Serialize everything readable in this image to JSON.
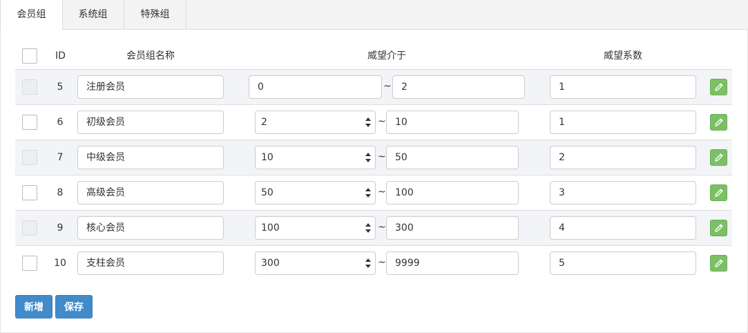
{
  "tabs": [
    {
      "label": "会员组",
      "active": true
    },
    {
      "label": "系统组",
      "active": false
    },
    {
      "label": "特殊组",
      "active": false
    }
  ],
  "table": {
    "headers": {
      "id": "ID",
      "name": "会员组名称",
      "range": "威望介于",
      "coef": "威望系数"
    },
    "separator": "~",
    "rows": [
      {
        "id": "5",
        "name": "注册会员",
        "min": "0",
        "max": "2",
        "coef": "1",
        "min_is_select": false
      },
      {
        "id": "6",
        "name": "初级会员",
        "min": "2",
        "max": "10",
        "coef": "1",
        "min_is_select": true
      },
      {
        "id": "7",
        "name": "中级会员",
        "min": "10",
        "max": "50",
        "coef": "2",
        "min_is_select": true
      },
      {
        "id": "8",
        "name": "高级会员",
        "min": "50",
        "max": "100",
        "coef": "3",
        "min_is_select": true
      },
      {
        "id": "9",
        "name": "核心会员",
        "min": "100",
        "max": "300",
        "coef": "4",
        "min_is_select": true
      },
      {
        "id": "10",
        "name": "支柱会员",
        "min": "300",
        "max": "9999",
        "coef": "5",
        "min_is_select": true
      }
    ]
  },
  "actions": {
    "add_label": "新增",
    "save_label": "保存"
  },
  "icons": {
    "edit": "pencil-icon",
    "select": "up-down-arrows-icon"
  },
  "colors": {
    "primary": "#428bca",
    "edit_button": "#7cc066",
    "stripe": "#f2f4f7"
  }
}
